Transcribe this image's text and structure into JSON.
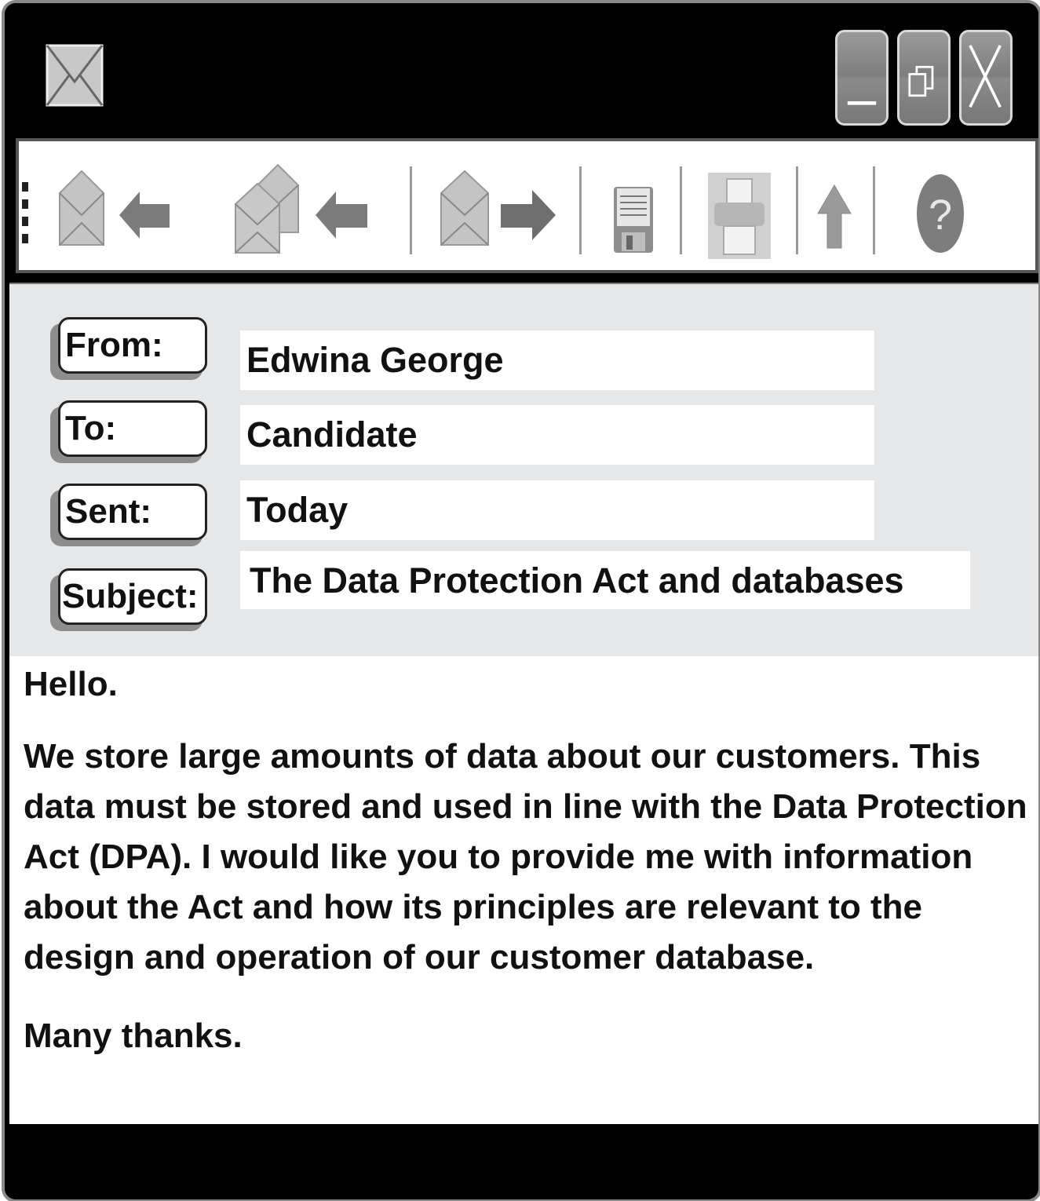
{
  "window": {
    "controls": {
      "minimize": "minimize-icon",
      "restore": "restore-icon",
      "close": "close-icon"
    }
  },
  "toolbar": {
    "icons": [
      "reply-icon",
      "reply-all-icon",
      "forward-icon",
      "save-icon",
      "print-icon",
      "upload-icon",
      "help-icon"
    ]
  },
  "header": {
    "from_label": "From:",
    "from_value": "Edwina George",
    "to_label": "To:",
    "to_value": "Candidate",
    "sent_label": "Sent:",
    "sent_value": "Today",
    "subject_label": "Subject:",
    "subject_value": "The Data Protection Act and databases"
  },
  "message": {
    "greeting": "Hello.",
    "paragraph": "We store large amounts of data about our customers. This data must be stored and used in line with the Data Protection Act (DPA). I would like you to provide me with information about the Act and how its principles are relevant to the design and operation of our customer database.",
    "signoff": "Many thanks."
  }
}
